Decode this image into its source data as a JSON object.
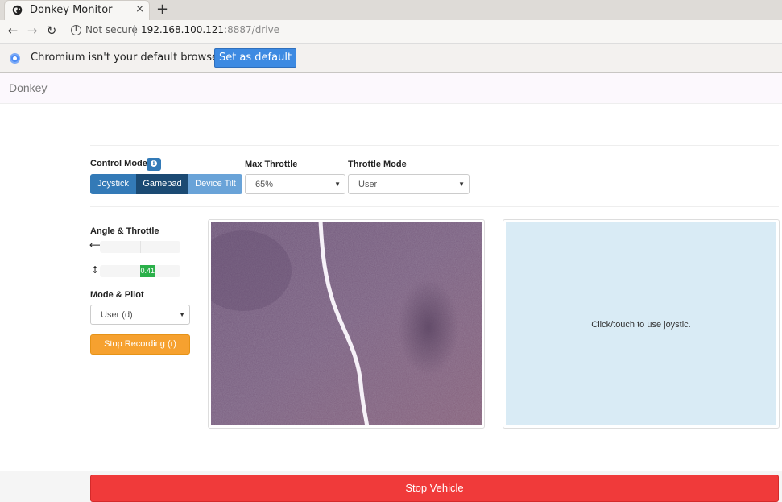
{
  "browser": {
    "tab_title": "Donkey Monitor",
    "tab_close": "×",
    "new_tab": "+",
    "back": "←",
    "forward": "→",
    "reload": "↻",
    "not_secure": "Not secure",
    "url_host": "192.168.100.121",
    "url_rest": ":8887/drive",
    "infobar_text": "Chromium isn't your default browser",
    "set_default": "Set as default"
  },
  "navbar": {
    "brand": "Donkey"
  },
  "controls": {
    "control_mode_label": "Control Mode",
    "modes": [
      "Joystick",
      "Gamepad",
      "Device Tilt"
    ],
    "active_mode": "Gamepad",
    "max_throttle_label": "Max Throttle",
    "max_throttle_value": "65%",
    "throttle_mode_label": "Throttle Mode",
    "throttle_mode_value": "User"
  },
  "telemetry": {
    "angle_throttle_label": "Angle & Throttle",
    "angle_icon": "⟷",
    "throttle_icon": "↕",
    "angle_value": 0,
    "throttle_value": 0.41,
    "throttle_label": "0.41"
  },
  "pilot": {
    "label": "Mode & Pilot",
    "value": "User (d)",
    "record_button": "Stop Recording (r)"
  },
  "joystick": {
    "hint": "Click/touch to use joystic."
  },
  "footer": {
    "stop_button": "Stop Vehicle"
  },
  "colors": {
    "primary": "#337ab7",
    "active": "#1b4a73",
    "warning": "#f6a12f",
    "danger": "#f03a3a",
    "success": "#2bb04a",
    "joystick_bg": "#d9ebf5"
  }
}
